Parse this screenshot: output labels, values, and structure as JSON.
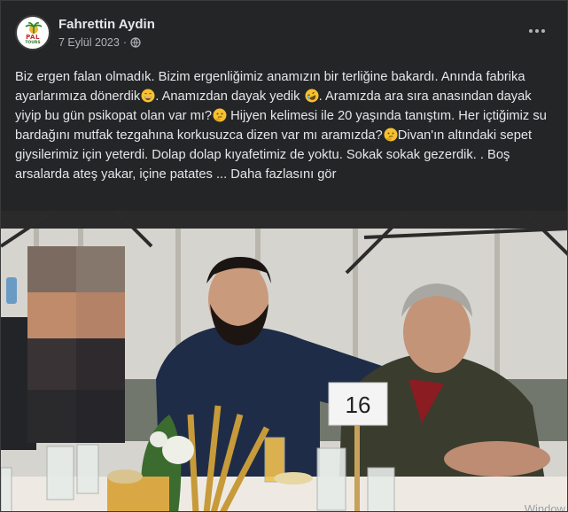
{
  "post": {
    "author": "Fahrettin Aydin",
    "date": "7 Eylül 2023",
    "dot": "·",
    "privacy_icon": "globe-icon",
    "menu_icon": "more-horizontal-icon",
    "avatar_logo_text": "PAL",
    "avatar_logo_sub": "TOURS",
    "text_1": "Biz ergen falan  olmadık. Bizim ergenliğimiz anamızın bir terliğine bakardı. Anında fabrika ayarlarımıza dönerdik",
    "text_2": ". Anamızdan dayak yedik ",
    "text_3": ". Aramızda ara sıra anasından dayak yiyip bu gün psikopat olan var mı?",
    "text_4": " Hijyen kelimesi ile 20 yaşında tanıştım. Her içtiğimiz su bardağını mutfak tezgahına korkusuzca dizen var mı aramızda?",
    "text_5": "Divan'ın altındaki sepet giysilerimiz için yeterdi. Dolap dolap kıyafetimiz de yoktu. Sokak sokak gezerdik. . Boş arsalarda ateş yakar, içine patates ... ",
    "see_more": "Daha fazlasını gör",
    "emojis": [
      "grin-emoji",
      "rofl-emoji",
      "thinking-emoji",
      "thinking-emoji"
    ]
  },
  "photo": {
    "table_number": "16",
    "watermark": "Window"
  },
  "colors": {
    "background": "#18191a",
    "card": "#242526",
    "text": "#e4e6eb",
    "secondary_text": "#b0b3b8"
  }
}
